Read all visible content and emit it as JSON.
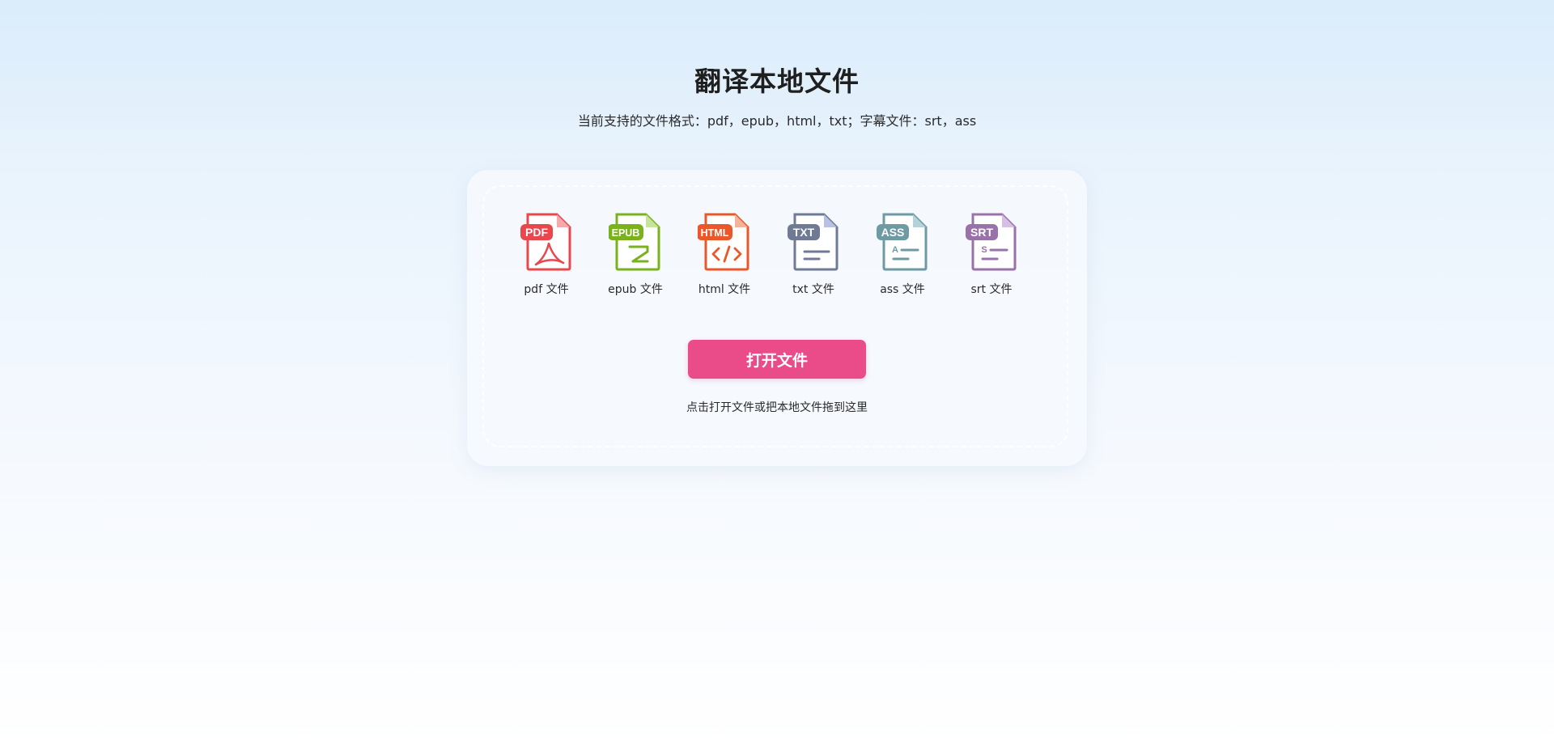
{
  "page": {
    "title": "翻译本地文件",
    "subtitle": "当前支持的文件格式：pdf，epub，html，txt；字幕文件：srt，ass"
  },
  "formats": [
    {
      "badge": "PDF",
      "label": "pdf 文件",
      "icon": "pdf-file-icon",
      "color": "#e8474d",
      "fold": "#f5a9ab"
    },
    {
      "badge": "EPUB",
      "label": "epub 文件",
      "icon": "epub-file-icon",
      "color": "#79b21d",
      "fold": "#c6e59a"
    },
    {
      "badge": "HTML",
      "label": "html 文件",
      "icon": "html-file-icon",
      "color": "#e9572b",
      "fold": "#f7b29a"
    },
    {
      "badge": "TXT",
      "label": "txt 文件",
      "icon": "txt-file-icon",
      "color": "#6f7b94",
      "fold": "#b8c0e3"
    },
    {
      "badge": "ASS",
      "label": "ass 文件",
      "icon": "ass-file-icon",
      "color": "#6d9aa3",
      "fold": "#b4d3d9"
    },
    {
      "badge": "SRT",
      "label": "srt 文件",
      "icon": "srt-file-icon",
      "color": "#9a72aa",
      "fold": "#d7bfe3"
    }
  ],
  "actions": {
    "open_label": "打开文件",
    "hint": "点击打开文件或把本地文件拖到这里"
  },
  "colors": {
    "primary_button": "#ea4c89",
    "background_top": "#dbecfb",
    "background_bottom": "#ffffff"
  }
}
